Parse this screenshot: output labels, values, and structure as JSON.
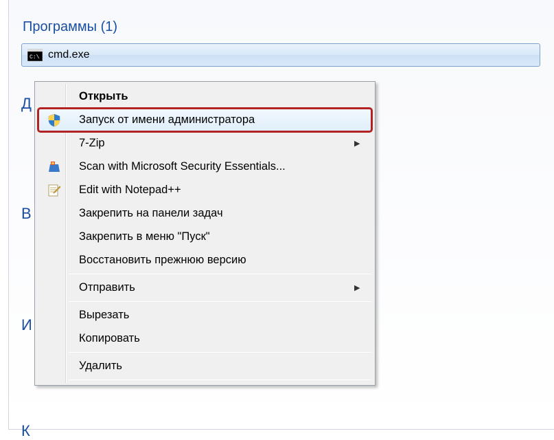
{
  "search": {
    "section_title": "Программы (1)",
    "result_label": "cmd.exe"
  },
  "bg_letters": {
    "d": "Д",
    "v": "В",
    "i": "И",
    "k": "К"
  },
  "menu": {
    "open": "Открыть",
    "run_as_admin": "Запуск от имени администратора",
    "seven_zip": "7-Zip",
    "scan_mse": "Scan with Microsoft Security Essentials...",
    "edit_npp": "Edit with Notepad++",
    "pin_taskbar": "Закрепить на панели задач",
    "pin_start": "Закрепить в меню \"Пуск\"",
    "restore_prev": "Восстановить прежнюю версию",
    "send_to": "Отправить",
    "cut": "Вырезать",
    "copy": "Копировать",
    "delete": "Удалить"
  }
}
